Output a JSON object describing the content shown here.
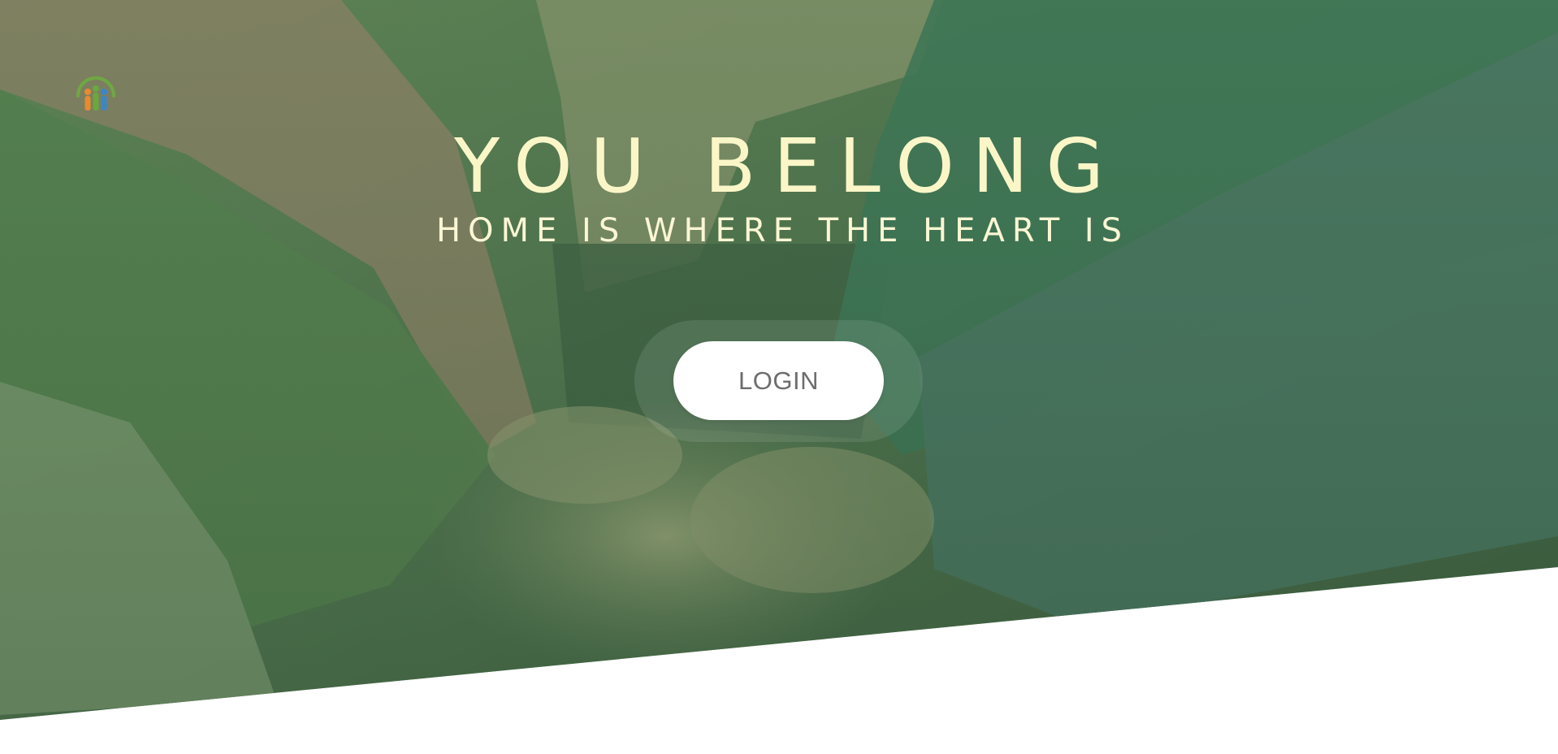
{
  "hero": {
    "headline": "YOU BELONG",
    "tagline": "HOME IS WHERE THE HEART IS",
    "login_label": "LOGIN",
    "background_image": "hands-stacked-photo",
    "logo_icon": "people-arc-logo-icon"
  },
  "colors": {
    "overlay_green": "#3f6b47",
    "headline_text": "#fbf6c8",
    "button_bg": "#ffffff",
    "button_text": "#6d6d6d",
    "logo_arc": "#6fa843",
    "logo_orange": "#e88a2e",
    "logo_green": "#6aa83f",
    "logo_blue": "#3b86c6"
  }
}
